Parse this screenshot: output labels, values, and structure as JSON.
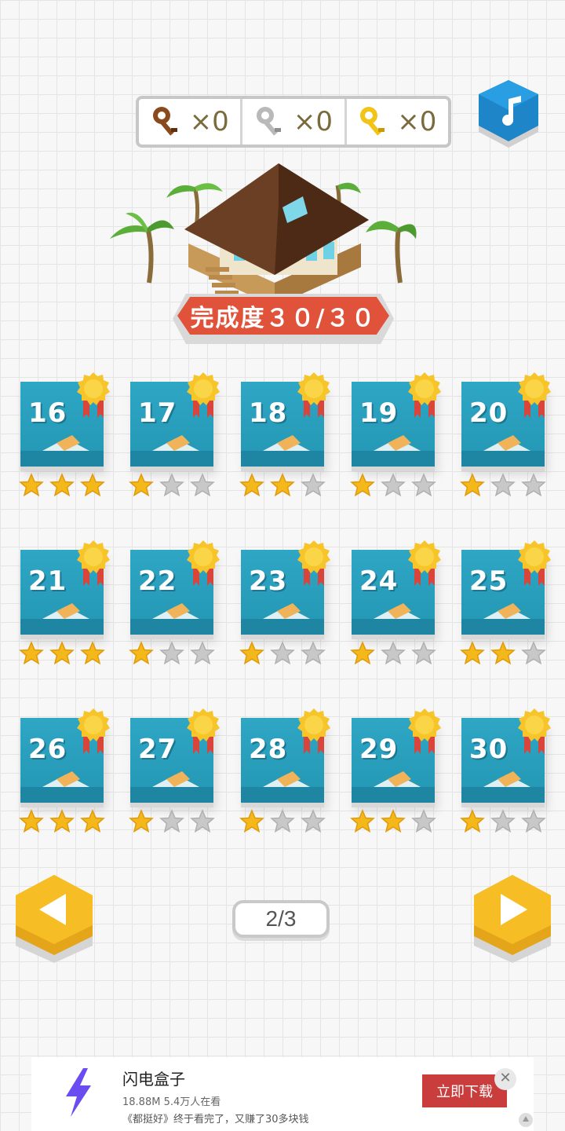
{
  "keys": [
    {
      "name": "bronze-key",
      "color": "#8a4a1c",
      "count": "×0"
    },
    {
      "name": "silver-key",
      "color": "#b9b9b9",
      "count": "×0"
    },
    {
      "name": "gold-key",
      "color": "#f2c418",
      "count": "×0"
    }
  ],
  "completion": {
    "label": "完成度３０/３０"
  },
  "levels": [
    {
      "num": "16",
      "stars": 3
    },
    {
      "num": "17",
      "stars": 1
    },
    {
      "num": "18",
      "stars": 2
    },
    {
      "num": "19",
      "stars": 1
    },
    {
      "num": "20",
      "stars": 1
    },
    {
      "num": "21",
      "stars": 3
    },
    {
      "num": "22",
      "stars": 1
    },
    {
      "num": "23",
      "stars": 1
    },
    {
      "num": "24",
      "stars": 1
    },
    {
      "num": "25",
      "stars": 2
    },
    {
      "num": "26",
      "stars": 3
    },
    {
      "num": "27",
      "stars": 1
    },
    {
      "num": "28",
      "stars": 1
    },
    {
      "num": "29",
      "stars": 2
    },
    {
      "num": "30",
      "stars": 1
    }
  ],
  "pagination": {
    "label": "2/3"
  },
  "ad": {
    "title": "闪电盒子",
    "meta": "18.88M 5.4万人在看",
    "description": "《都挺好》终于看完了，又赚了30多块钱",
    "button": "立即下载",
    "close": "✕"
  },
  "colors": {
    "accent_blue": "#2ea6c4",
    "accent_red": "#e0533a",
    "gold": "#f5c518"
  }
}
